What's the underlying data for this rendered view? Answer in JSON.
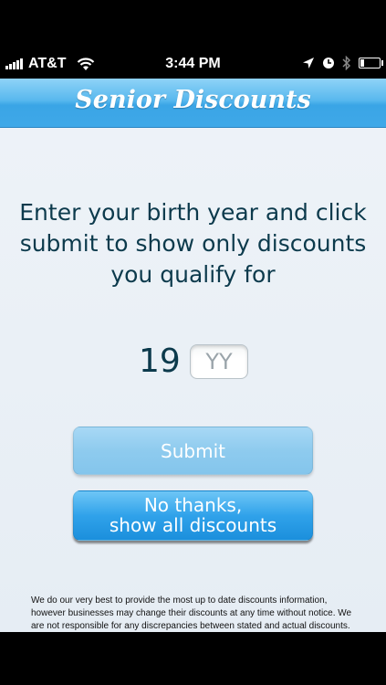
{
  "status_bar": {
    "carrier": "AT&T",
    "time": "3:44 PM",
    "icons": [
      "signal-icon",
      "wifi-icon",
      "location-icon",
      "alarm-icon",
      "bluetooth-icon",
      "battery-icon"
    ],
    "battery_level": 0.2
  },
  "nav": {
    "title": "Senior Discounts"
  },
  "main": {
    "instructions": "Enter your birth year and click submit to show only discounts you qualify for",
    "year_prefix": "19",
    "year_placeholder": "YY",
    "year_value": ""
  },
  "buttons": {
    "submit_label": "Submit",
    "show_all_line1": "No thanks,",
    "show_all_line2": "show all discounts"
  },
  "disclaimer": "We do our very best to provide the most up to date discounts information, however businesses may change their discounts at any time without notice. We are not responsible for any discrepancies between stated and actual discounts.",
  "colors": {
    "nav_bar": "#3aa5e6",
    "text_primary": "#0c3a4c",
    "submit_button": "#8ecbee",
    "show_all_button": "#1b8fdc"
  }
}
